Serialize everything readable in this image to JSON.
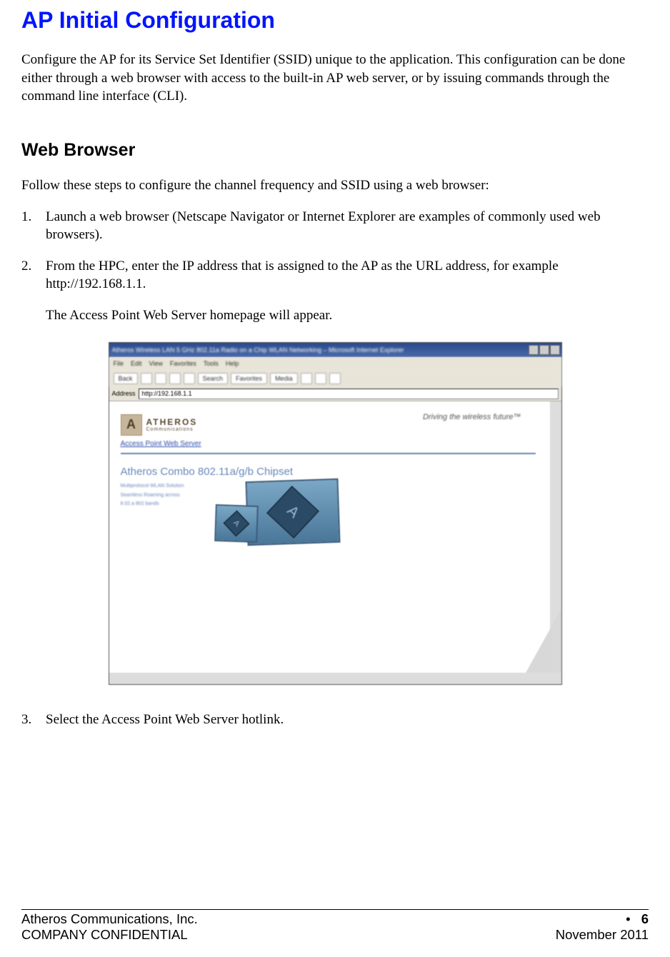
{
  "title": "AP Initial Configuration",
  "intro": "Configure the AP for its Service Set Identifier (SSID) unique to the application. This configuration can be done either through a web browser with access to the built-in AP web server, or by issuing commands through the command line interface (CLI).",
  "section1": {
    "heading": "Web Browser",
    "lead": "Follow these steps to configure the channel frequency and SSID using a web browser:",
    "steps": [
      {
        "num": "1.",
        "text": "Launch a web browser (Netscape Navigator or Internet Explorer are examples of commonly used web browsers)."
      },
      {
        "num": "2.",
        "text": "From the HPC, enter the IP address that is assigned to the AP as the URL address, for example http://192.168.1.1.",
        "sub": "The Access Point Web Server homepage will appear."
      },
      {
        "num": "3.",
        "text": "Select the Access Point Web Server hotlink."
      }
    ]
  },
  "ie": {
    "title_text": "Atheros Wireless LAN 5 GHz 802.11a Radio on a Chip WLAN Networking – Microsoft Internet Explorer",
    "menus": [
      "File",
      "Edit",
      "View",
      "Favorites",
      "Tools",
      "Help"
    ],
    "toolbar": {
      "back": "Back",
      "search": "Search",
      "favorites": "Favorites",
      "media": "Media"
    },
    "addr_label": "Address",
    "addr_value": "http://192.168.1.1",
    "content": {
      "brand": "ATHEROS",
      "brand_sub": "Communications",
      "tagline": "Driving the wireless future™",
      "link": "Access Point Web Server",
      "chipset": "Atheros Combo 802.11a/g/b Chipset",
      "features": [
        "Multiprotocol WLAN Solution",
        "Seamless Roaming across",
        "8.02.a 802 bands"
      ]
    }
  },
  "footer": {
    "company": "Atheros Communications, Inc.",
    "confidential": "COMPANY CONFIDENTIAL",
    "bullet": "•",
    "page": "6",
    "date": "November 2011"
  }
}
